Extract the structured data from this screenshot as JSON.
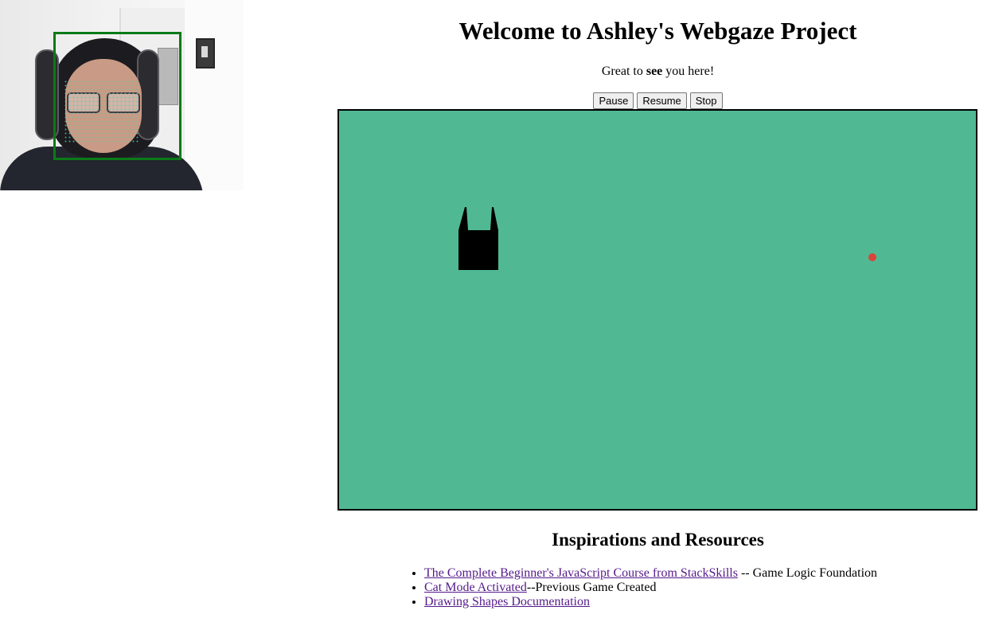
{
  "header": {
    "title": "Welcome to Ashley's Webgaze Project",
    "subtitle_before": "Great to",
    "subtitle_bold": "see",
    "subtitle_after": "you here!"
  },
  "controls": {
    "pause_label": "Pause",
    "resume_label": "Resume",
    "stop_label": "Stop"
  },
  "game": {
    "background_color": "#50b994",
    "cat_color": "#000000",
    "target_color": "#d9453a"
  },
  "resources": {
    "heading": "Inspirations and Resources",
    "items": [
      {
        "link": "The Complete Beginner's JavaScript Course from StackSkills",
        "suffix": " -- Game Logic Foundation"
      },
      {
        "link": "Cat Mode Activated",
        "suffix": "--Previous Game Created"
      },
      {
        "link": "Drawing Shapes Documentation",
        "suffix": ""
      }
    ]
  }
}
